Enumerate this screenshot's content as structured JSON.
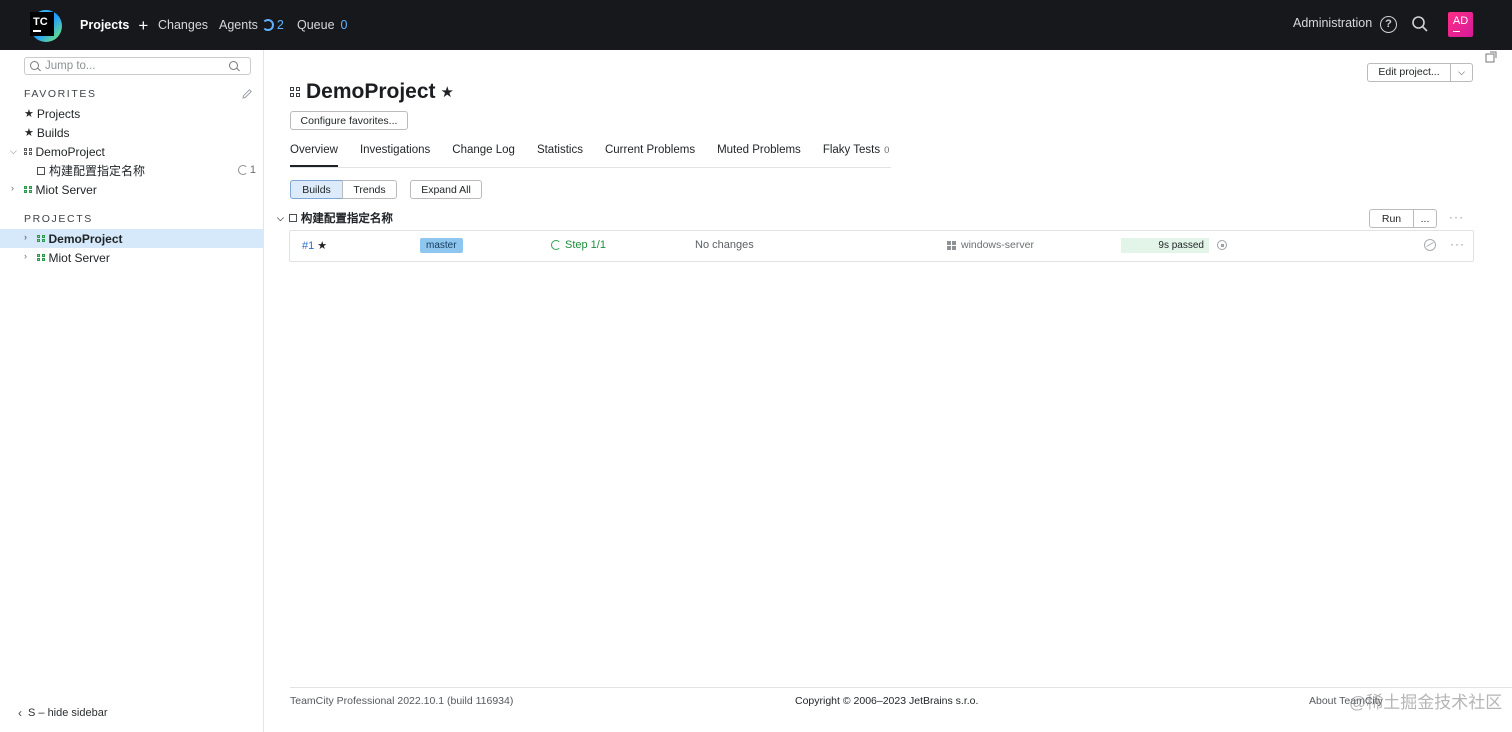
{
  "topnav": {
    "logo_text": "TC",
    "projects": "Projects",
    "changes": "Changes",
    "agents": "Agents",
    "agents_count": "2",
    "queue": "Queue",
    "queue_count": "0",
    "administration": "Administration",
    "avatar_initials": "AD",
    "accent": "#5fb2ff"
  },
  "sidebar": {
    "jump_placeholder": "Jump to...",
    "favorites_header": "FAVORITES",
    "favorites": [
      {
        "label": "Projects",
        "icon": "star-icon"
      },
      {
        "label": "Builds",
        "icon": "star-icon"
      },
      {
        "label": "DemoProject",
        "icon": "project-icon"
      },
      {
        "label": "构建配置指定名称",
        "icon": "build-config-icon",
        "running": "1"
      },
      {
        "label": "Miot Server",
        "icon": "project-icon"
      }
    ],
    "projects_header": "PROJECTS",
    "projects": [
      {
        "label": "DemoProject",
        "selected": true
      },
      {
        "label": "Miot Server",
        "selected": false
      }
    ],
    "hide_label": "S – hide sidebar"
  },
  "main": {
    "title": "DemoProject",
    "configure_favorites": "Configure favorites...",
    "edit_project": "Edit project...",
    "tabs": [
      {
        "label": "Overview",
        "active": true
      },
      {
        "label": "Investigations"
      },
      {
        "label": "Change Log"
      },
      {
        "label": "Statistics"
      },
      {
        "label": "Current Problems"
      },
      {
        "label": "Muted Problems"
      },
      {
        "label": "Flaky Tests",
        "count": "0"
      }
    ],
    "view_toggle": {
      "builds": "Builds",
      "trends": "Trends"
    },
    "expand_all": "Expand All",
    "build_config": {
      "name": "构建配置指定名称",
      "run": "Run",
      "run_more": "...",
      "build": {
        "number": "#1",
        "branch": "master",
        "step": "Step 1/1",
        "changes": "No changes",
        "agent": "windows-server",
        "status": "9s passed"
      }
    }
  },
  "footer": {
    "version": "TeamCity Professional 2022.10.1 (build 116934)",
    "copyright": "Copyright © 2006–2023 JetBrains s.r.o.",
    "about": "About TeamCity",
    "watermark": "@稀土掘金技术社区"
  }
}
